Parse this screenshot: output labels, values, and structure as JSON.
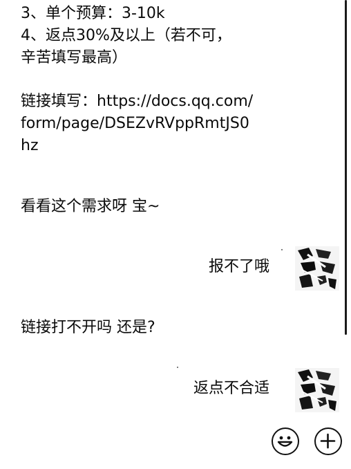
{
  "messages": [
    {
      "side": "left",
      "lines": [
        "3、单个预算：3-10k",
        "4、返点30%及以上（若不可，",
        "辛苦填写最高）"
      ]
    },
    {
      "side": "left",
      "lines": [
        "链接填写：https://docs.qq.com/",
        "form/page/DSEZvRVppRmtJS0",
        "hz"
      ]
    },
    {
      "side": "left",
      "lines": [
        "看看这个需求呀 宝~"
      ]
    },
    {
      "side": "right",
      "lines": [
        "报不了哦"
      ],
      "avatar": "user-avatar"
    },
    {
      "side": "left",
      "lines": [
        "链接打不开吗 还是?"
      ]
    },
    {
      "side": "right",
      "lines": [
        "返点不合适"
      ],
      "avatar": "user-avatar"
    }
  ],
  "toolbar": {
    "emoji_icon": "smiley-icon",
    "add_icon": "plus-circle-icon"
  }
}
